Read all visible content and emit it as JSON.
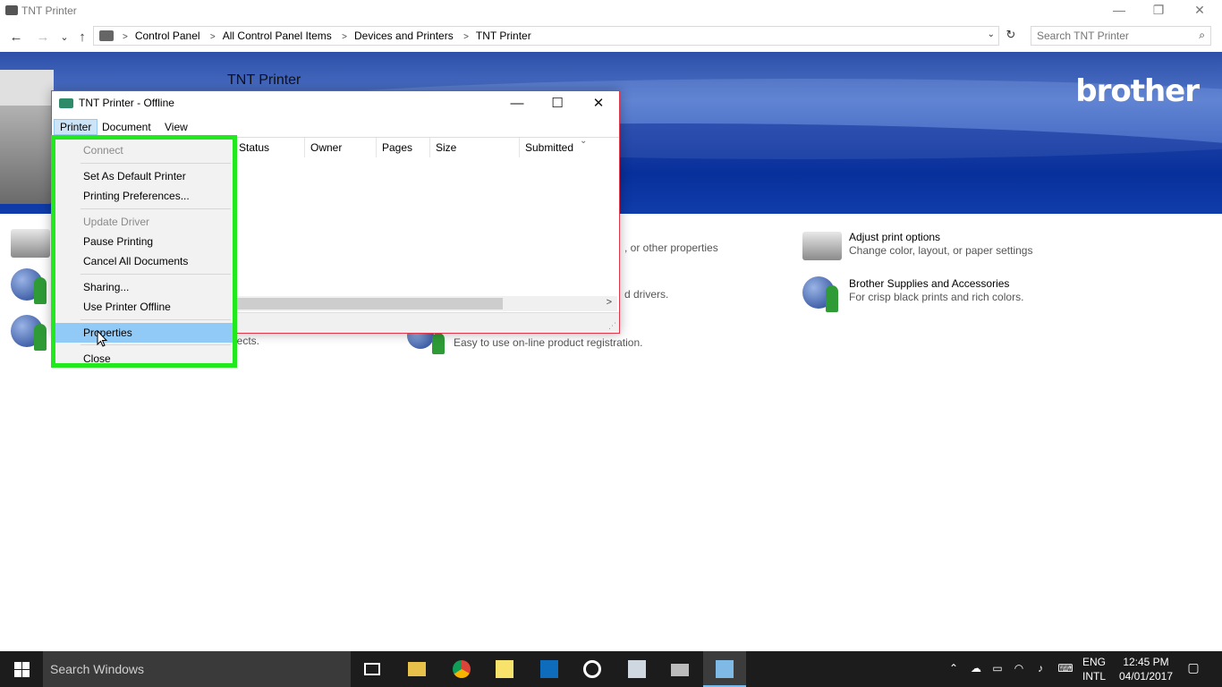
{
  "window": {
    "title": "TNT Printer",
    "minimize": "—",
    "restore": "❐",
    "close": "✕"
  },
  "nav": {
    "back": "←",
    "forward": "→",
    "recent": "⌄",
    "up": "↑"
  },
  "breadcrumbs": [
    "Control Panel",
    "All Control Panel Items",
    "Devices and Printers",
    "TNT Printer"
  ],
  "search": {
    "placeholder": "Search TNT Printer"
  },
  "banner": {
    "title": "TNT Printer",
    "brand": "brother"
  },
  "tasks": {
    "adjust": {
      "name": "Adjust print options",
      "desc": "Change color, layout, or paper settings"
    },
    "supplies": {
      "name": "Brother Supplies and Accessories",
      "desc": "For crisp black prints and rich colors."
    },
    "partial1": ", or other properties",
    "partial2": "d drivers.",
    "partial3": "jects.",
    "partial4": "Easy to use on-line product registration."
  },
  "queue": {
    "title": "TNT Printer - Offline",
    "menus": [
      "Printer",
      "Document",
      "View"
    ],
    "columns": [
      "Status",
      "Owner",
      "Pages",
      "Size",
      "Submitted"
    ]
  },
  "menu": {
    "items": [
      {
        "label": "Connect",
        "disabled": true
      },
      {
        "label": "Set As Default Printer"
      },
      {
        "label": "Printing Preferences..."
      },
      {
        "label": "Update Driver",
        "disabled": true
      },
      {
        "label": "Pause Printing"
      },
      {
        "label": "Cancel All Documents"
      },
      {
        "label": "Sharing..."
      },
      {
        "label": "Use Printer Offline"
      },
      {
        "label": "Properties",
        "highlighted": true
      },
      {
        "label": "Close"
      }
    ]
  },
  "taskbar": {
    "search_placeholder": "Search Windows",
    "lang_line1": "ENG",
    "lang_line2": "INTL",
    "time": "12:45 PM",
    "date": "04/01/2017"
  },
  "colors": {
    "highlight_border": "#22e81e",
    "menu_hover": "#91c9f7",
    "queue_border": "#e0374d"
  }
}
